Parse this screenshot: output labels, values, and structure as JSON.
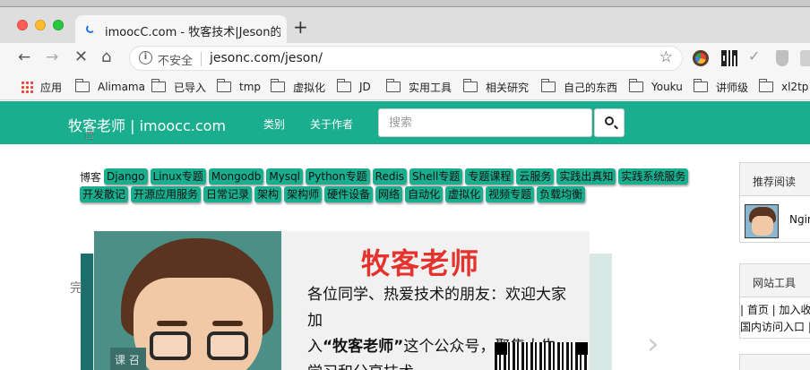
{
  "browser": {
    "tab_title": "imoocC.com - 牧客技术|Jeson的",
    "new_tab_symbol": "+",
    "url_security": "不安全",
    "url": "jesonc.com/jeson/"
  },
  "bookmarks": [
    {
      "label": "应用",
      "icon": "apps-grid-icon"
    },
    {
      "label": "Alimama",
      "icon": "folder-icon"
    },
    {
      "label": "已导入",
      "icon": "folder-icon"
    },
    {
      "label": "tmp",
      "icon": "folder-icon"
    },
    {
      "label": "虚拟化",
      "icon": "folder-icon"
    },
    {
      "label": "JD",
      "icon": "folder-icon"
    },
    {
      "label": "实用工具",
      "icon": "folder-icon"
    },
    {
      "label": "相关研究",
      "icon": "folder-icon"
    },
    {
      "label": "自己的东西",
      "icon": "folder-icon"
    },
    {
      "label": "Youku",
      "icon": "folder-icon"
    },
    {
      "label": "讲师级",
      "icon": "folder-icon"
    },
    {
      "label": "xl2tp",
      "icon": "folder-icon"
    }
  ],
  "site": {
    "logo": "牧客老师 | imoocc.com",
    "nav": [
      "类别",
      "关于作者"
    ],
    "search_placeholder": "搜索",
    "brand_color": "#1aae8f"
  },
  "tags": {
    "lead": "博客",
    "row1": [
      "Django",
      "Linux专题",
      "Mongodb",
      "Mysql",
      "Python专题",
      "Redis",
      "Shell专题",
      "专题课程",
      "云服务",
      "实践出真知",
      "实践系统服务"
    ],
    "row2": [
      "开发散记",
      "开源应用服务",
      "日常记录",
      "架构",
      "架构师",
      "硬件设备",
      "网络",
      "自动化",
      "虚拟化",
      "视频专题",
      "负载均衡"
    ]
  },
  "main": {
    "cut_text": "完",
    "chevron_left": "‹",
    "chevron_right": "›"
  },
  "banner": {
    "title": "牧客老师",
    "line1": "各位同学、热爱技术的朋友：欢迎大家加",
    "line2_prefix": "入",
    "line2_bold": "“牧客老师”",
    "line2_suffix": "这个公众号，聚集大牛，",
    "line3": "学习和分享技术。",
    "avatar_badge": "课 召"
  },
  "sidebar": {
    "recommend_title": "推荐阅读",
    "recommend_item": "Ngin",
    "tools_title": "网站工具",
    "tools_line1": "| 首页 | 加入收藏",
    "tools_line2": "国内访问入口 |"
  }
}
